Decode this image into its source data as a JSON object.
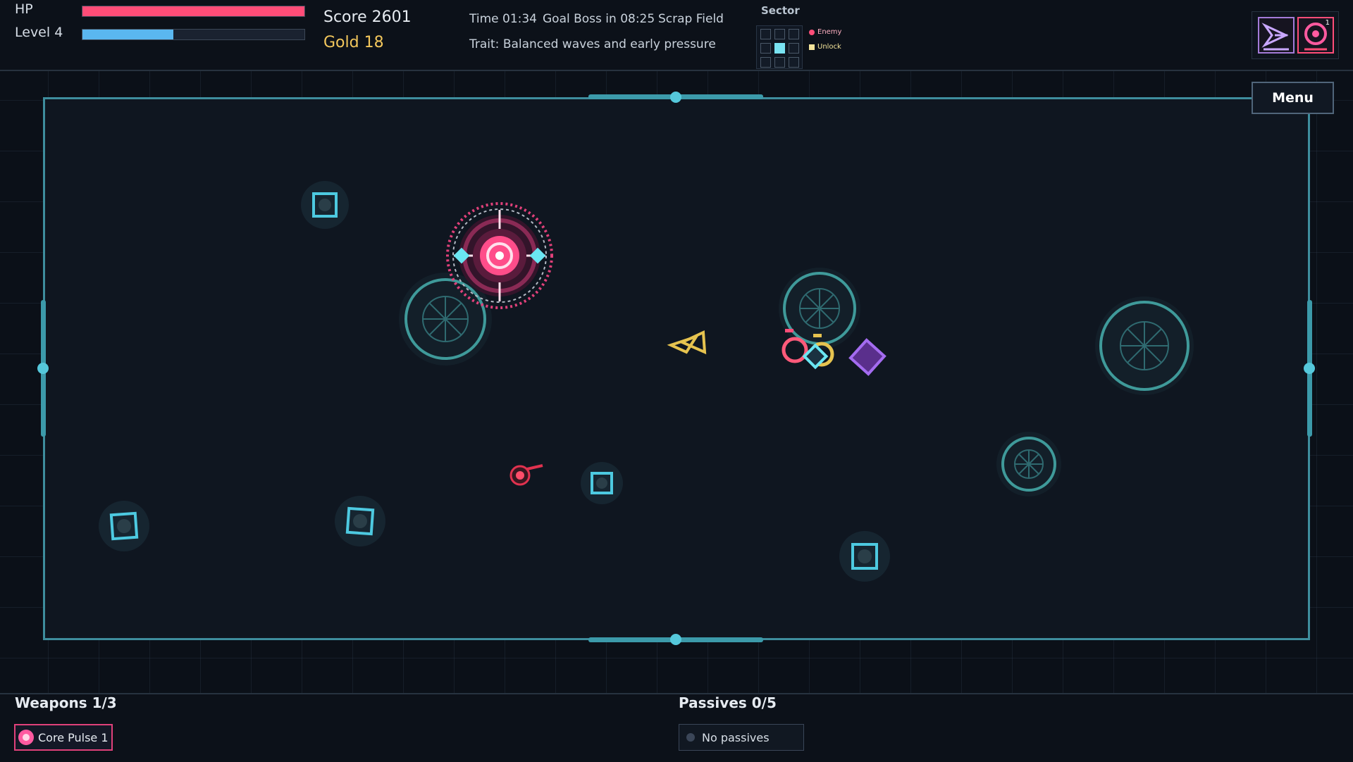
{
  "hud": {
    "hp_label": "HP",
    "hp_fraction": 1.0,
    "hp_color": "#ff4d78",
    "level_label": "Level 4",
    "xp_fraction": 0.41,
    "xp_color": "#5ab7f0",
    "score": "Score 2601",
    "gold": "Gold 18",
    "gold_color": "#f3c75c",
    "time": "Time 01:34",
    "goal": "Goal Boss in 08:25",
    "zone": "Scrap Field",
    "trait": "Trait: Balanced waves and early pressure"
  },
  "sector": {
    "title": "Sector",
    "legend_enemy": "Enemy",
    "legend_unlock": "Unlock",
    "enemy_color": "#ff4d78",
    "unlock_color": "#f3e39a",
    "grid": [
      0,
      0,
      0,
      0,
      1,
      0,
      0,
      0,
      0
    ]
  },
  "top_icons": {
    "dash_icon": "dash-arrow-icon",
    "pulse_icon": "core-pulse-icon",
    "pulse_badge": "1"
  },
  "menu": {
    "label": "Menu"
  },
  "weapons": {
    "title": "Weapons 1/3",
    "items": [
      {
        "label": "Core Pulse 1",
        "icon": "core-pulse-icon"
      }
    ]
  },
  "passives": {
    "title": "Passives 0/5",
    "empty_label": "No passives"
  },
  "colors": {
    "arena_border": "#3e8d9d",
    "accent_cyan": "#55c8db",
    "player_pink": "#ff4d78",
    "enemy_yellow": "#e6c34f",
    "enemy_purple": "#a46cf0"
  }
}
